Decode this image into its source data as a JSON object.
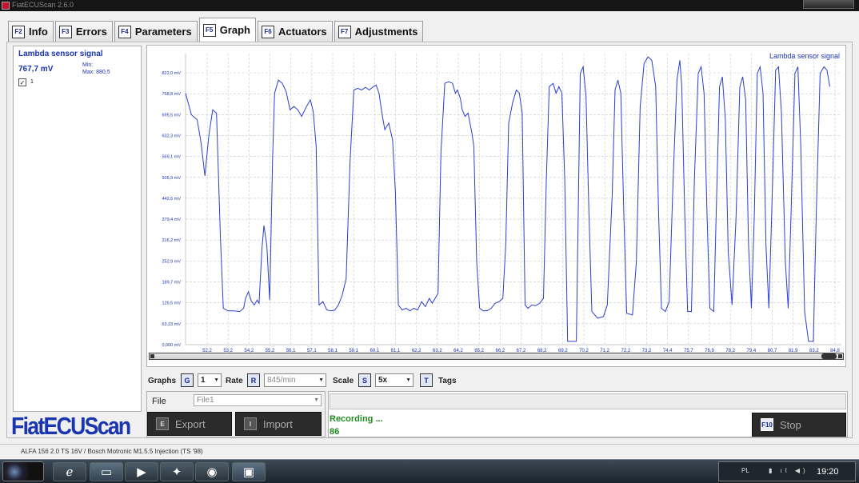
{
  "window": {
    "title": "FiatECUScan 2.6.0"
  },
  "tabs": [
    {
      "key": "F2",
      "label": "Info"
    },
    {
      "key": "F3",
      "label": "Errors"
    },
    {
      "key": "F4",
      "label": "Parameters"
    },
    {
      "key": "F5",
      "label": "Graph",
      "active": true
    },
    {
      "key": "F6",
      "label": "Actuators"
    },
    {
      "key": "F7",
      "label": "Adjustments"
    }
  ],
  "sensor": {
    "title": "Lambda sensor signal",
    "value": "767,7 mV",
    "min_label": "Min:",
    "max_label": "Max: 880,5",
    "checkbox_label": "1"
  },
  "logo": "FiatECUScan",
  "controls": {
    "graphs_label": "Graphs",
    "graphs_key": "G",
    "graphs_value": "1",
    "rate_label": "Rate",
    "rate_key": "R",
    "rate_value": "845/min",
    "scale_label": "Scale",
    "scale_key": "S",
    "scale_value": "5x",
    "tags_key": "T",
    "tags_label": "Tags"
  },
  "file": {
    "label": "File",
    "value": "File1",
    "export_key": "E",
    "export_label": "Export",
    "import_key": "I",
    "import_label": "Import"
  },
  "status": {
    "recording": "Recording ...",
    "count": "86",
    "stop_key": "F10",
    "stop_label": "Stop"
  },
  "infobar": "ALFA 156 2.0 TS 16V / Bosch Motronic M1.5.5 Injection (TS '98)",
  "taskbar": {
    "lang": "PL",
    "clock": "19:20"
  },
  "colors": {
    "accent": "#1a35b0",
    "line": "#2b3fd1",
    "recording": "#1f8a1f"
  },
  "chart_data": {
    "type": "line",
    "legend": "Lambda sensor signal",
    "y_ticks": [
      "0,000 mV",
      "63,23 mV",
      "126,5 mV",
      "189,7 mV",
      "252,9 mV",
      "316,2 mV",
      "379,4 mV",
      "442,6 mV",
      "505,9 mV",
      "569,1 mV",
      "632,3 mV",
      "695,5 mV",
      "758,8 mV",
      "822,0 mV"
    ],
    "x_ticks": [
      "52,2",
      "53,2",
      "54,2",
      "55,2",
      "56,1",
      "57,1",
      "58,1",
      "59,1",
      "60,1",
      "61,1",
      "62,2",
      "63,2",
      "64,2",
      "65,2",
      "66,2",
      "67,2",
      "68,2",
      "69,2",
      "70,2",
      "71,2",
      "72,2",
      "73,2",
      "74,4",
      "75,7",
      "76,9",
      "78,2",
      "79,4",
      "80,7",
      "81,9",
      "83,2",
      "84,8"
    ],
    "xlim": [
      51.3,
      85.2
    ],
    "ylim": [
      0,
      880
    ],
    "grid": true,
    "values": [
      [
        51.3,
        760
      ],
      [
        51.6,
        695
      ],
      [
        51.9,
        680
      ],
      [
        52.1,
        610
      ],
      [
        52.3,
        510
      ],
      [
        52.5,
        630
      ],
      [
        52.7,
        710
      ],
      [
        52.9,
        700
      ],
      [
        53.1,
        330
      ],
      [
        53.25,
        110
      ],
      [
        53.5,
        102
      ],
      [
        53.8,
        102
      ],
      [
        54.1,
        100
      ],
      [
        54.3,
        110
      ],
      [
        54.4,
        140
      ],
      [
        54.55,
        160
      ],
      [
        54.7,
        132
      ],
      [
        54.85,
        120
      ],
      [
        55.0,
        135
      ],
      [
        55.1,
        125
      ],
      [
        55.25,
        290
      ],
      [
        55.35,
        360
      ],
      [
        55.5,
        300
      ],
      [
        55.65,
        135
      ],
      [
        55.8,
        560
      ],
      [
        55.9,
        760
      ],
      [
        56.1,
        800
      ],
      [
        56.3,
        790
      ],
      [
        56.5,
        765
      ],
      [
        56.7,
        710
      ],
      [
        56.9,
        720
      ],
      [
        57.1,
        710
      ],
      [
        57.3,
        690
      ],
      [
        57.55,
        720
      ],
      [
        57.75,
        740
      ],
      [
        57.9,
        705
      ],
      [
        58.05,
        600
      ],
      [
        58.2,
        120
      ],
      [
        58.4,
        130
      ],
      [
        58.6,
        105
      ],
      [
        58.8,
        102
      ],
      [
        59.0,
        104
      ],
      [
        59.2,
        120
      ],
      [
        59.4,
        150
      ],
      [
        59.6,
        200
      ],
      [
        59.8,
        550
      ],
      [
        60.0,
        770
      ],
      [
        60.2,
        775
      ],
      [
        60.4,
        770
      ],
      [
        60.6,
        778
      ],
      [
        60.8,
        770
      ],
      [
        61.0,
        780
      ],
      [
        61.15,
        785
      ],
      [
        61.3,
        760
      ],
      [
        61.45,
        700
      ],
      [
        61.6,
        650
      ],
      [
        61.8,
        670
      ],
      [
        62.0,
        620
      ],
      [
        62.15,
        460
      ],
      [
        62.3,
        120
      ],
      [
        62.5,
        105
      ],
      [
        62.7,
        110
      ],
      [
        62.9,
        102
      ],
      [
        63.1,
        110
      ],
      [
        63.3,
        105
      ],
      [
        63.5,
        130
      ],
      [
        63.7,
        115
      ],
      [
        63.9,
        140
      ],
      [
        64.05,
        125
      ],
      [
        64.2,
        140
      ],
      [
        64.35,
        155
      ],
      [
        64.5,
        580
      ],
      [
        64.7,
        790
      ],
      [
        64.9,
        795
      ],
      [
        65.1,
        790
      ],
      [
        65.25,
        760
      ],
      [
        65.35,
        770
      ],
      [
        65.5,
        745
      ],
      [
        65.6,
        710
      ],
      [
        65.75,
        690
      ],
      [
        65.9,
        700
      ],
      [
        66.1,
        640
      ],
      [
        66.2,
        600
      ],
      [
        66.35,
        250
      ],
      [
        66.5,
        110
      ],
      [
        66.7,
        102
      ],
      [
        66.9,
        103
      ],
      [
        67.1,
        110
      ],
      [
        67.3,
        125
      ],
      [
        67.5,
        130
      ],
      [
        67.7,
        140
      ],
      [
        67.85,
        300
      ],
      [
        68.0,
        670
      ],
      [
        68.2,
        730
      ],
      [
        68.4,
        770
      ],
      [
        68.55,
        760
      ],
      [
        68.7,
        700
      ],
      [
        68.85,
        120
      ],
      [
        69.0,
        110
      ],
      [
        69.2,
        120
      ],
      [
        69.4,
        118
      ],
      [
        69.6,
        125
      ],
      [
        69.8,
        140
      ],
      [
        69.95,
        500
      ],
      [
        70.1,
        780
      ],
      [
        70.3,
        790
      ],
      [
        70.45,
        760
      ],
      [
        70.6,
        780
      ],
      [
        70.75,
        760
      ],
      [
        70.9,
        500
      ],
      [
        71.05,
        10
      ],
      [
        71.3,
        10
      ],
      [
        71.5,
        10
      ],
      [
        71.7,
        820
      ],
      [
        71.85,
        840
      ],
      [
        72.0,
        750
      ],
      [
        72.15,
        400
      ],
      [
        72.3,
        100
      ],
      [
        72.6,
        80
      ],
      [
        72.9,
        85
      ],
      [
        73.1,
        120
      ],
      [
        73.35,
        450
      ],
      [
        73.5,
        770
      ],
      [
        73.65,
        800
      ],
      [
        73.8,
        760
      ],
      [
        73.95,
        400
      ],
      [
        74.1,
        95
      ],
      [
        74.4,
        90
      ],
      [
        74.6,
        250
      ],
      [
        74.8,
        720
      ],
      [
        75.0,
        850
      ],
      [
        75.2,
        870
      ],
      [
        75.4,
        860
      ],
      [
        75.6,
        780
      ],
      [
        75.75,
        400
      ],
      [
        75.9,
        110
      ],
      [
        76.1,
        100
      ],
      [
        76.3,
        130
      ],
      [
        76.5,
        500
      ],
      [
        76.7,
        800
      ],
      [
        76.85,
        860
      ],
      [
        76.95,
        780
      ],
      [
        77.1,
        400
      ],
      [
        77.25,
        100
      ],
      [
        77.45,
        100
      ],
      [
        77.6,
        500
      ],
      [
        77.8,
        820
      ],
      [
        77.95,
        840
      ],
      [
        78.1,
        760
      ],
      [
        78.25,
        400
      ],
      [
        78.4,
        110
      ],
      [
        78.6,
        100
      ],
      [
        78.75,
        450
      ],
      [
        78.9,
        780
      ],
      [
        79.05,
        810
      ],
      [
        79.2,
        680
      ],
      [
        79.35,
        280
      ],
      [
        79.55,
        120
      ],
      [
        79.75,
        380
      ],
      [
        79.95,
        780
      ],
      [
        80.1,
        810
      ],
      [
        80.25,
        740
      ],
      [
        80.4,
        300
      ],
      [
        80.55,
        110
      ],
      [
        80.7,
        400
      ],
      [
        80.85,
        820
      ],
      [
        81.0,
        840
      ],
      [
        81.15,
        760
      ],
      [
        81.3,
        300
      ],
      [
        81.45,
        110
      ],
      [
        81.6,
        400
      ],
      [
        81.8,
        830
      ],
      [
        81.95,
        840
      ],
      [
        82.1,
        700
      ],
      [
        82.3,
        250
      ],
      [
        82.45,
        110
      ],
      [
        82.6,
        400
      ],
      [
        82.8,
        820
      ],
      [
        82.95,
        840
      ],
      [
        83.1,
        600
      ],
      [
        83.3,
        100
      ],
      [
        83.5,
        10
      ],
      [
        83.75,
        10
      ],
      [
        83.9,
        400
      ],
      [
        84.1,
        820
      ],
      [
        84.3,
        840
      ],
      [
        84.45,
        830
      ],
      [
        84.6,
        780
      ]
    ]
  }
}
